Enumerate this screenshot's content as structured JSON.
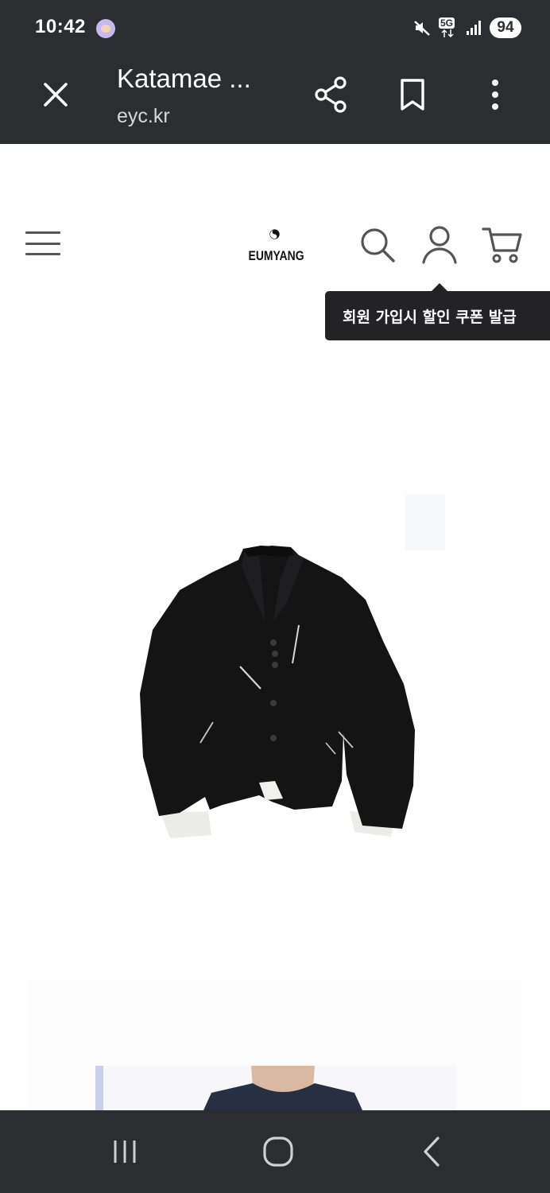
{
  "status_bar": {
    "time": "10:42",
    "network": "5G",
    "battery": "94",
    "icons": [
      "notification-app-icon",
      "mute-icon",
      "5g-icon",
      "signal-icon",
      "battery-icon"
    ]
  },
  "custom_tab": {
    "title": "Katamae ...",
    "url": "eyc.kr",
    "icons": [
      "close-icon",
      "share-icon",
      "bookmark-icon",
      "more-vert-icon"
    ]
  },
  "site": {
    "logo_text": "EUMYANG",
    "icons": [
      "menu-icon",
      "search-icon",
      "account-icon",
      "cart-icon"
    ],
    "tooltip": "회원 가입시 할인 쿠폰 발급"
  },
  "product": {
    "image_description_icon": "black-jacket-image"
  },
  "nav_bar": {
    "icons": [
      "recent-apps-icon",
      "home-icon",
      "back-icon"
    ]
  },
  "colors": {
    "chrome_bg": "#2c2d31",
    "page_bg": "#ffffff",
    "tooltip_bg": "#232325",
    "icon_gray": "#555555"
  }
}
